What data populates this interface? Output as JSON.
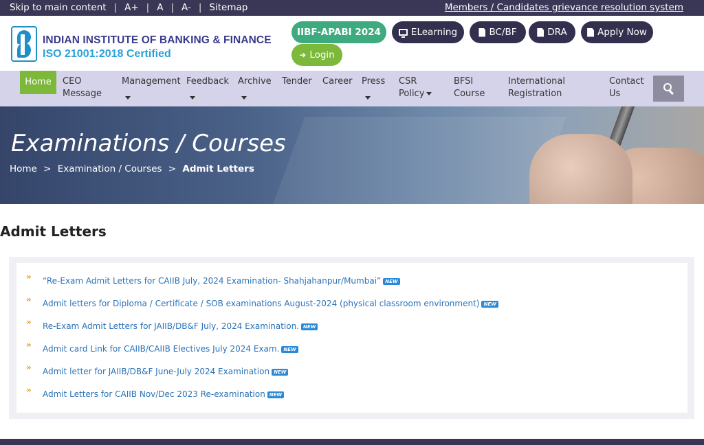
{
  "topbar": {
    "skip": "Skip to main content",
    "a_plus": "A+",
    "a": "A",
    "a_minus": "A-",
    "sitemap": "Sitemap",
    "sep": "|",
    "grievance": "Members / Candidates grievance resolution system"
  },
  "header": {
    "org_name": "INDIAN INSTITUTE OF BANKING & FINANCE",
    "iso": "ISO 21001:2018 Certified",
    "buttons": {
      "apabi": "IIBF-APABI 2024",
      "elearning": "ELearning",
      "bcbf": "BC/BF",
      "dra": "DRA",
      "apply": "Apply Now",
      "login": "Login"
    },
    "login_icon": "➜"
  },
  "nav": {
    "home": "Home",
    "ceo_1": "CEO",
    "ceo_2": "Message",
    "management": "Management",
    "feedback": "Feedback",
    "archive": "Archive",
    "tender": "Tender",
    "career": "Career",
    "press": "Press",
    "csr_1": "CSR",
    "csr_2": "Policy",
    "bfsi_1": "BFSI",
    "bfsi_2": "Course",
    "intl_1": "International",
    "intl_2": "Registration",
    "contact_1": "Contact",
    "contact_2": "Us"
  },
  "banner": {
    "title": "Examinations / Courses",
    "crumbs": [
      "Home",
      "Examination / Courses",
      "Admit Letters"
    ],
    "sep": ">"
  },
  "content": {
    "heading": "Admit Letters",
    "chevron": "»",
    "new_label": "NEW",
    "links": [
      "“Re-Exam Admit Letters for CAIIB July, 2024 Examination- Shahjahanpur/Mumbai”",
      "Admit letters for Diploma / Certificate / SOB examinations August-2024 (physical classroom environment)",
      "Re-Exam Admit Letters for JAIIB/DB&F July, 2024 Examination.",
      "Admit card Link for CAIIB/CAIIB Electives July 2024 Exam.",
      "Admit letter for JAIIB/DB&F June-July 2024 Examination",
      "Admit Letters for CAIIB Nov/Dec 2023 Re-examination"
    ]
  },
  "colors": {
    "topbar": "#3a3656",
    "nav": "#d4d3ea",
    "home_active": "#7cb83a",
    "apabi": "#3eaa7f",
    "dark_pill": "#33304f",
    "link": "#2a72b8",
    "chevron": "#e8a020"
  }
}
